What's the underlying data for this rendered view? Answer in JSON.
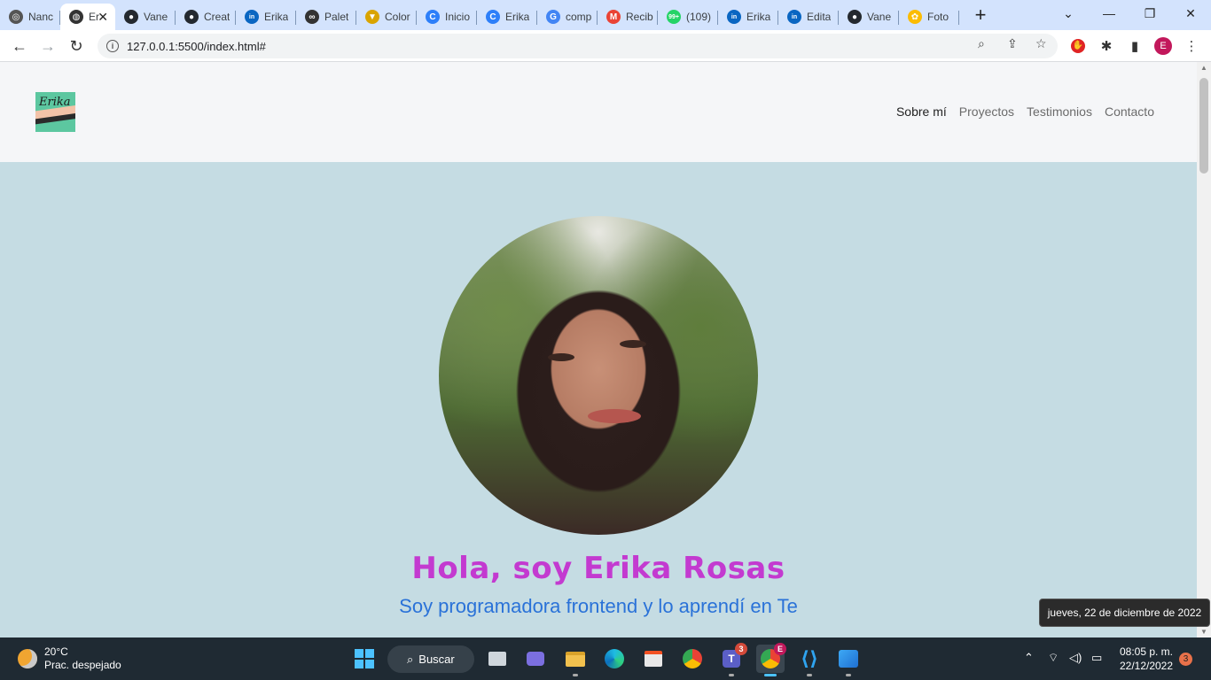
{
  "browser": {
    "tabs": [
      {
        "label": "Nanc",
        "favicon": "nancy-icon",
        "color": "#555555",
        "glyph": "◎"
      },
      {
        "label": "Er",
        "favicon": "globe-icon",
        "color": "#333333",
        "glyph": "◍",
        "active": true
      },
      {
        "label": "Vane",
        "favicon": "github-icon",
        "color": "#24292f",
        "glyph": "●"
      },
      {
        "label": "Creat",
        "favicon": "github-icon",
        "color": "#24292f",
        "glyph": "●"
      },
      {
        "label": "Erika",
        "favicon": "linkedin-icon",
        "color": "#0a66c2",
        "glyph": "in"
      },
      {
        "label": "Palet",
        "favicon": "link-icon",
        "color": "#333333",
        "glyph": "∞"
      },
      {
        "label": "Color",
        "favicon": "colors-icon",
        "color": "#d9a400",
        "glyph": "▼"
      },
      {
        "label": "Inicio",
        "favicon": "canva-icon",
        "color": "#2d7ff9",
        "glyph": "C"
      },
      {
        "label": "Erika",
        "favicon": "canva-icon",
        "color": "#2d7ff9",
        "glyph": "C"
      },
      {
        "label": "comp",
        "favicon": "google-icon",
        "color": "#4285f4",
        "glyph": "G"
      },
      {
        "label": "Recib",
        "favicon": "gmail-icon",
        "color": "#ea4335",
        "glyph": "M"
      },
      {
        "label": "(109)",
        "favicon": "whatsapp-icon",
        "color": "#25d366",
        "glyph": "99+"
      },
      {
        "label": "Erika",
        "favicon": "linkedin-icon",
        "color": "#0a66c2",
        "glyph": "in"
      },
      {
        "label": "Edita",
        "favicon": "linkedin-icon",
        "color": "#0a66c2",
        "glyph": "in"
      },
      {
        "label": "Vane",
        "favicon": "github-icon",
        "color": "#24292f",
        "glyph": "●"
      },
      {
        "label": "Foto",
        "favicon": "google-photos-icon",
        "color": "#fbbc04",
        "glyph": "✿"
      }
    ],
    "new_tab": "+",
    "url": "127.0.0.1:5500/index.html#",
    "profile_initial": "E"
  },
  "site": {
    "nav": {
      "links": [
        {
          "label": "Sobre mí",
          "current": true
        },
        {
          "label": "Proyectos"
        },
        {
          "label": "Testimonios"
        },
        {
          "label": "Contacto"
        }
      ]
    },
    "logo_text": "Erika",
    "hero": {
      "title": "Hola, soy Erika Rosas",
      "subtitle": "Soy programadora frontend y lo aprendí en Te"
    },
    "colors": {
      "background": "#c5dce3",
      "nav_background": "#f5f6f8",
      "title": "#c33ad0",
      "subtitle": "#2a72d8"
    }
  },
  "tooltip": "jueves, 22 de diciembre de 2022",
  "taskbar": {
    "weather": {
      "temp": "20°C",
      "desc": "Prac. despejado"
    },
    "search_label": "Buscar",
    "teams_badge": "3",
    "chrome_badge": "E",
    "clock": {
      "time": "08:05 p. m.",
      "date": "22/12/2022"
    },
    "notifications": "3"
  }
}
